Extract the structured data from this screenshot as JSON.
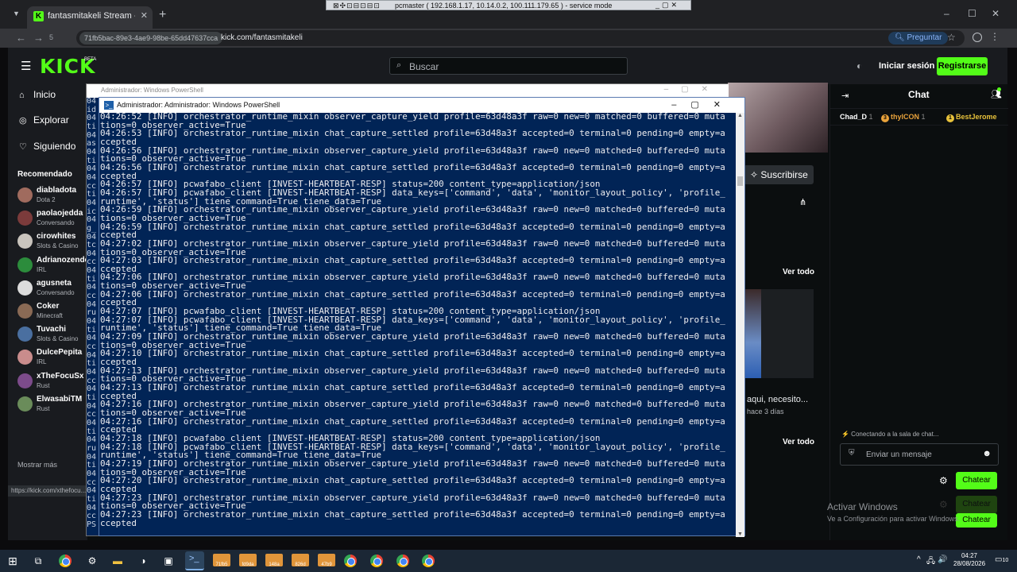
{
  "browser": {
    "tab_title": "fantasmitakeli Stream - Watch L",
    "tab_favicon": "K",
    "tab_close": "✕",
    "new_tab": "+",
    "window_controls": [
      "–",
      "☐",
      "✕"
    ],
    "url_id": "71fb5bac-89e3-4ae9-98be-65dd47637cca",
    "url": "kick.com/fantasmitakeli",
    "ask_button": "Preguntar",
    "reload_badge": "5",
    "status_url": "https://kick.com/xthefocu..."
  },
  "remote_session": {
    "title": "pcmaster ( 192.168.1.17, 10.14.0.2, 100.111.179.65 ) - service mode",
    "tool_icons": "⊠✣⊡⊟⊡⊟⊡",
    "controls": "_▢✕"
  },
  "kick": {
    "logo": "KICK",
    "beta": "BETA",
    "search_placeholder": "Buscar",
    "login": "Iniciar sesión",
    "signup": "Registrarse",
    "nav": [
      {
        "icon": "⌂",
        "label": "Inicio"
      },
      {
        "icon": "◎",
        "label": "Explorar"
      },
      {
        "icon": "♡",
        "label": "Siguiendo"
      }
    ],
    "recommended_title": "Recomendado",
    "channels": [
      {
        "name": "diabladota",
        "category": "Dota 2",
        "color": "#a06b5e"
      },
      {
        "name": "paolaojedda",
        "category": "Conversando",
        "color": "#7b3b3b"
      },
      {
        "name": "cirowhites",
        "category": "Slots & Casino",
        "color": "#c9c4bd"
      },
      {
        "name": "Adrianozende",
        "category": "IRL",
        "color": "#2c8c3c"
      },
      {
        "name": "agusneta",
        "category": "Conversando",
        "color": "#dcdcdc"
      },
      {
        "name": "Coker",
        "category": "Minecraft",
        "color": "#8a6a55"
      },
      {
        "name": "Tuvachi",
        "category": "Slots & Casino",
        "color": "#4a6fa0"
      },
      {
        "name": "DulcePepita",
        "category": "IRL",
        "color": "#c98c8c"
      },
      {
        "name": "xTheFocuSx",
        "category": "Rust",
        "color": "#7c4b8a"
      },
      {
        "name": "ElwasabiTM",
        "category": "Rust",
        "color": "#6a8c5a"
      }
    ],
    "show_more": "Mostrar más",
    "subscribe": "Suscribirse",
    "see_all": "Ver todo",
    "video_title": "aqui, necesito...",
    "video_ago": "hace 3 días",
    "chat": {
      "title": "Chat",
      "gifters": [
        {
          "rank": "",
          "name": "Chad_D",
          "count": "1",
          "color": "#ffffff"
        },
        {
          "rank": "3",
          "name": "thylCON",
          "count": "1",
          "color": "#e8a23b"
        },
        {
          "rank": "1",
          "name": "BestJerome",
          "count": "",
          "color": "#e8c23b"
        }
      ],
      "connecting": "⚡ Conectando a la sala de chat...",
      "placeholder": "Enviar un mensaje",
      "send": "Chatear"
    },
    "activate_title": "Activar Windows",
    "activate_sub": "Ve a Configuración para activar Windows."
  },
  "ps_back": {
    "title": "Administrador: Windows PowerShell",
    "edge_text": "04\nid\n04\nti\n04\nas\n04\nti\n04\n04\ncc\nti\n04\nic\n04\ng_\n04\ntc\n04\ncc\n04\nti\n04\ncc\n04\nru\n04\nti\n04\ncc\n04\nti\n04\ncc\n04\nti\n04\ncc\n04\nti\n04\nru\n04\nti\n04\ncc\n04\nti\n04\ncc\nPS"
  },
  "ps": {
    "title": "Administrador: Administrador: Windows PowerShell",
    "lines": [
      "04:26:52 [INFO] orchestrator_runtime_mixin observer_capture_yield profile=63d48a3f raw=0 new=0 matched=0 buffered=0 muta",
      "tions=0 observer_active=True",
      "04:26:53 [INFO] orchestrator_runtime_mixin chat_capture_settled profile=63d48a3f accepted=0 terminal=0 pending=0 empty=a",
      "ccepted",
      "04:26:56 [INFO] orchestrator_runtime_mixin observer_capture_yield profile=63d48a3f raw=0 new=0 matched=0 buffered=0 muta",
      "tions=0 observer_active=True",
      "04:26:56 [INFO] orchestrator_runtime_mixin chat_capture_settled profile=63d48a3f accepted=0 terminal=0 pending=0 empty=a",
      "ccepted",
      "04:26:57 [INFO] pcwafabo_client [INVEST-HEARTBEAT-RESP] status=200 content_type=application/json",
      "04:26:57 [INFO] pcwafabo_client [INVEST-HEARTBEAT-RESP] data_keys=['command', 'data', 'monitor_layout_policy', 'profile_",
      "runtime', 'status'] tiene_command=True tiene_data=True",
      "04:26:59 [INFO] orchestrator_runtime_mixin observer_capture_yield profile=63d48a3f raw=0 new=0 matched=0 buffered=0 muta",
      "tions=0 observer_active=True",
      "04:26:59 [INFO] orchestrator_runtime_mixin chat_capture_settled profile=63d48a3f accepted=0 terminal=0 pending=0 empty=a",
      "ccepted",
      "04:27:02 [INFO] orchestrator_runtime_mixin observer_capture_yield profile=63d48a3f raw=0 new=0 matched=0 buffered=0 muta",
      "tions=0 observer_active=True",
      "04:27:03 [INFO] orchestrator_runtime_mixin chat_capture_settled profile=63d48a3f accepted=0 terminal=0 pending=0 empty=a",
      "ccepted",
      "04:27:06 [INFO] orchestrator_runtime_mixin observer_capture_yield profile=63d48a3f raw=0 new=0 matched=0 buffered=0 muta",
      "tions=0 observer_active=True",
      "04:27:06 [INFO] orchestrator_runtime_mixin chat_capture_settled profile=63d48a3f accepted=0 terminal=0 pending=0 empty=a",
      "ccepted",
      "04:27:07 [INFO] pcwafabo_client [INVEST-HEARTBEAT-RESP] status=200 content_type=application/json",
      "04:27:07 [INFO] pcwafabo_client [INVEST-HEARTBEAT-RESP] data_keys=['command', 'data', 'monitor_layout_policy', 'profile_",
      "runtime', 'status'] tiene_command=True tiene_data=True",
      "04:27:09 [INFO] orchestrator_runtime_mixin observer_capture_yield profile=63d48a3f raw=0 new=0 matched=0 buffered=0 muta",
      "tions=0 observer_active=True",
      "04:27:10 [INFO] orchestrator_runtime_mixin chat_capture_settled profile=63d48a3f accepted=0 terminal=0 pending=0 empty=a",
      "ccepted",
      "04:27:13 [INFO] orchestrator_runtime_mixin observer_capture_yield profile=63d48a3f raw=0 new=0 matched=0 buffered=0 muta",
      "tions=0 observer_active=True",
      "04:27:13 [INFO] orchestrator_runtime_mixin chat_capture_settled profile=63d48a3f accepted=0 terminal=0 pending=0 empty=a",
      "ccepted",
      "04:27:16 [INFO] orchestrator_runtime_mixin observer_capture_yield profile=63d48a3f raw=0 new=0 matched=0 buffered=0 muta",
      "tions=0 observer_active=True",
      "04:27:16 [INFO] orchestrator_runtime_mixin chat_capture_settled profile=63d48a3f accepted=0 terminal=0 pending=0 empty=a",
      "ccepted",
      "04:27:18 [INFO] pcwafabo_client [INVEST-HEARTBEAT-RESP] status=200 content_type=application/json",
      "04:27:18 [INFO] pcwafabo_client [INVEST-HEARTBEAT-RESP] data_keys=['command', 'data', 'monitor_layout_policy', 'profile_",
      "runtime', 'status'] tiene_command=True tiene_data=True",
      "04:27:19 [INFO] orchestrator_runtime_mixin observer_capture_yield profile=63d48a3f raw=0 new=0 matched=0 buffered=0 muta",
      "tions=0 observer_active=True",
      "04:27:20 [INFO] orchestrator_runtime_mixin chat_capture_settled profile=63d48a3f accepted=0 terminal=0 pending=0 empty=a",
      "ccepted",
      "04:27:23 [INFO] orchestrator_runtime_mixin observer_capture_yield profile=63d48a3f raw=0 new=0 matched=0 buffered=0 muta",
      "tions=0 observer_active=True",
      "04:27:23 [INFO] orchestrator_runtime_mixin chat_capture_settled profile=63d48a3f accepted=0 terminal=0 pending=0 empty=a",
      "ccepted"
    ]
  },
  "taskbar": {
    "folders": [
      "71fb5",
      "fd9da",
      "148a",
      "826d",
      "47b9"
    ],
    "tray_icons": [
      "^",
      "🖧",
      "🔊",
      "⌨"
    ],
    "time": "04:27",
    "date": "28/08/2026",
    "notifications": "10"
  },
  "colors": {
    "kick_green": "#53fc18",
    "powershell_bg": "#012456",
    "taskbar": "#1b2735"
  }
}
